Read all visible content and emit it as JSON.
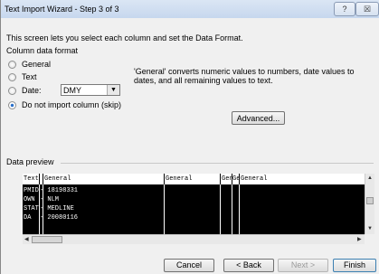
{
  "window": {
    "title": "Text Import Wizard - Step 3 of 3",
    "help_glyph": "?",
    "close_glyph": "☒"
  },
  "intro": "This screen lets you select each column and set the Data Format.",
  "column_format": {
    "label": "Column data format",
    "options": {
      "general": "General",
      "text": "Text",
      "date": "Date:",
      "skip": "Do not import column (skip)"
    },
    "selected": "skip",
    "date_format": "DMY"
  },
  "description": "'General' converts numeric values to numbers, date values to dates, and all remaining values to text.",
  "advanced_label": "Advanced...",
  "preview": {
    "label": "Data preview",
    "headers": [
      "Text",
      "General",
      "General",
      "Gen",
      "Ge",
      "General"
    ],
    "rows": [
      [
        "PMID",
        "- 18198331"
      ],
      [
        "OWN",
        "- NLM"
      ],
      [
        "STAT",
        "- MEDLINE"
      ],
      [
        "DA",
        "- 20080116"
      ]
    ]
  },
  "buttons": {
    "cancel": "Cancel",
    "back": "< Back",
    "next": "Next >",
    "finish": "Finish"
  }
}
